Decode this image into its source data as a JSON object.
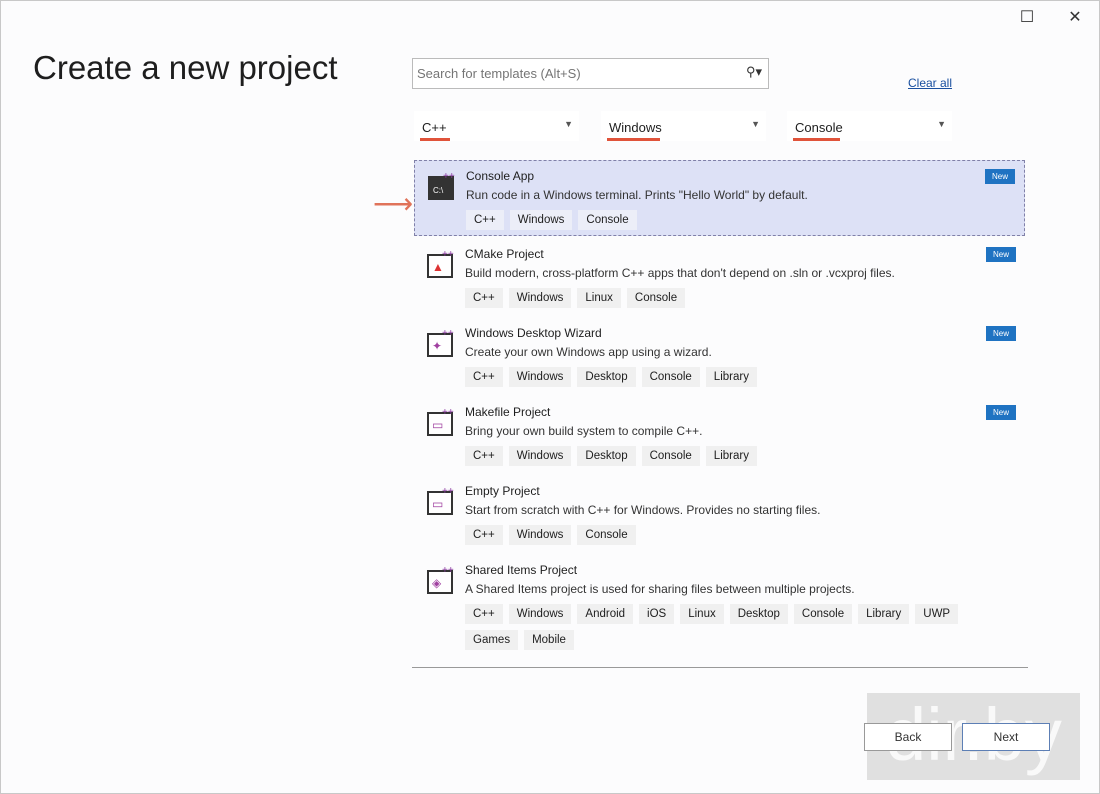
{
  "window": {
    "maximize_icon": "maximize-icon",
    "close_icon": "close-icon"
  },
  "page_title": "Create a new project",
  "search": {
    "placeholder": "Search for templates (Alt+S)",
    "icon": "search-icon"
  },
  "clear_all": "Clear all",
  "filters": [
    {
      "label": "C++"
    },
    {
      "label": "Windows"
    },
    {
      "label": "Console"
    }
  ],
  "templates": [
    {
      "title": "Console App",
      "description": "Run code in a Windows terminal. Prints \"Hello World\" by default.",
      "tags": [
        "C++",
        "Windows",
        "Console"
      ],
      "badge": "New",
      "selected": true
    },
    {
      "title": "CMake Project",
      "description": "Build modern, cross-platform C++ apps that don't depend on .sln or .vcxproj files.",
      "tags": [
        "C++",
        "Windows",
        "Linux",
        "Console"
      ],
      "badge": "New"
    },
    {
      "title": "Windows Desktop Wizard",
      "description": "Create your own Windows app using a wizard.",
      "tags": [
        "C++",
        "Windows",
        "Desktop",
        "Console",
        "Library"
      ],
      "badge": "New"
    },
    {
      "title": "Makefile Project",
      "description": "Bring your own build system to compile C++.",
      "tags": [
        "C++",
        "Windows",
        "Desktop",
        "Console",
        "Library"
      ],
      "badge": "New"
    },
    {
      "title": "Empty Project",
      "description": "Start from scratch with C++ for Windows. Provides no starting files.",
      "tags": [
        "C++",
        "Windows",
        "Console"
      ]
    },
    {
      "title": "Shared Items Project",
      "description": "A Shared Items project is used for sharing files between multiple projects.",
      "tags": [
        "C++",
        "Windows",
        "Android",
        "iOS",
        "Linux",
        "Desktop",
        "Console",
        "Library",
        "UWP",
        "Games",
        "Mobile"
      ]
    }
  ],
  "buttons": {
    "back": "Back",
    "next": "Next"
  },
  "watermark": "dir.by",
  "colors": {
    "accent": "#1f73c2",
    "selected_bg": "#dde1f6",
    "underline": "#e0533a"
  }
}
